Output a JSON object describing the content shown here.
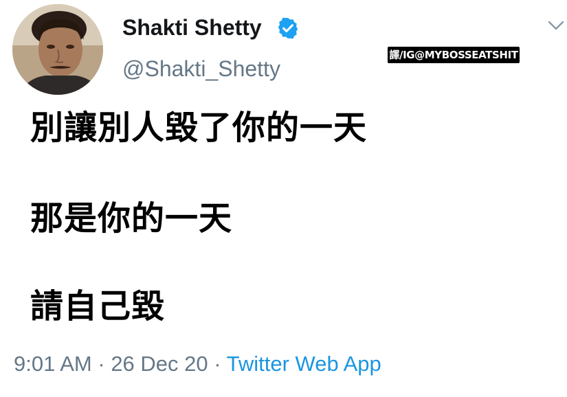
{
  "user": {
    "display_name": "Shakti Shetty",
    "handle": "@Shakti_Shetty",
    "verified_icon": "verified-badge-icon",
    "avatar_icon": "profile-photo"
  },
  "watermark": {
    "text": "譯/IG@MYBOSSEATSHIT"
  },
  "tweet": {
    "lines": [
      "別讓別人毀了你的一天",
      "那是你的一天",
      "請自己毀"
    ]
  },
  "meta": {
    "time": "9:01 AM",
    "sep1": " · ",
    "date": "26 Dec 20",
    "sep2": " · ",
    "source": "Twitter Web App"
  },
  "menu": {
    "icon": "chevron-down-icon"
  },
  "colors": {
    "text_primary": "#14171a",
    "text_secondary": "#657786",
    "link": "#1b95e0",
    "verified": "#1da1f2"
  }
}
